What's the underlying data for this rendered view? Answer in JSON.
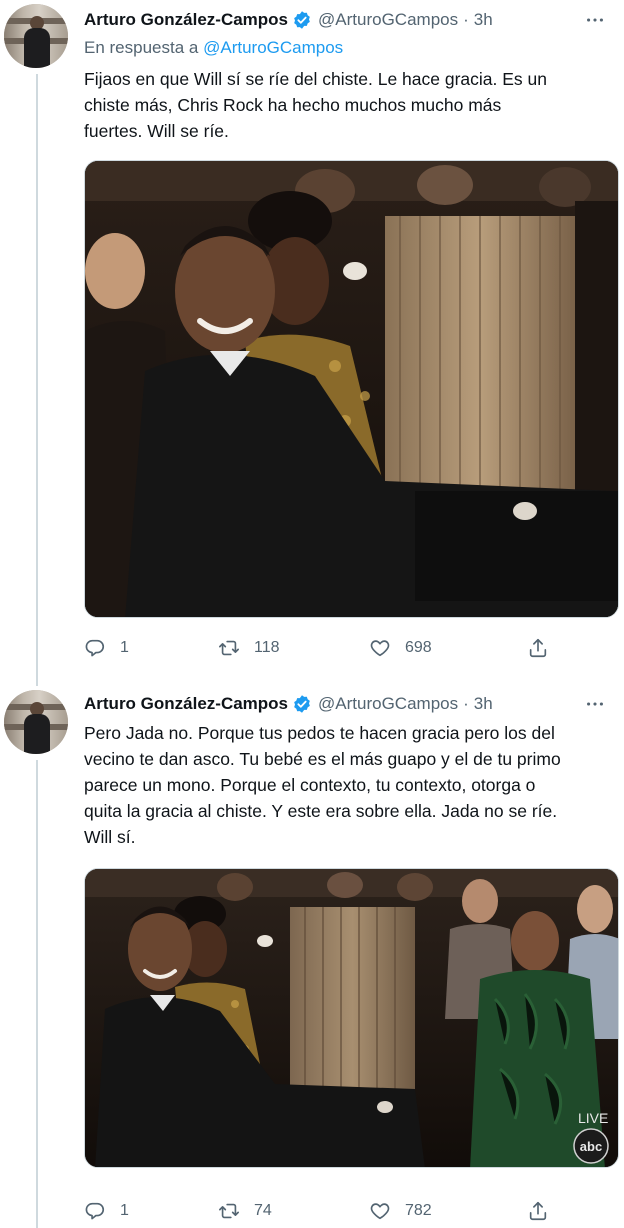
{
  "tweets": [
    {
      "name": "Arturo González-Campos",
      "handle": "@ArturoGCampos",
      "dot": "·",
      "time": "3h",
      "reply_prefix": "En respuesta a",
      "reply_handle": "@ArturoGCampos",
      "lines": [
        "Fijaos en que Will sí se ríe del chiste. Le hace gracia. Es un",
        "chiste más, Chris Rock ha hecho muchos mucho más",
        "fuertes. Will se ríe."
      ],
      "replies": "1",
      "retweets": "118",
      "likes": "698"
    },
    {
      "name": "Arturo González-Campos",
      "handle": "@ArturoGCampos",
      "dot": "·",
      "time": "3h",
      "lines": [
        "Pero Jada no. Porque tus pedos te hacen gracia pero los del",
        "vecino te dan asco. Tu bebé es el más guapo y el de tu primo",
        "parece un mono. Porque el contexto, tu contexto, otorga o",
        "quita la gracia al chiste. Y este era sobre ella. Jada no se ríe.",
        "Will sí."
      ],
      "replies": "1",
      "retweets": "74",
      "likes": "782",
      "media_overlay": {
        "live": "LIVE",
        "network": "abc"
      }
    }
  ],
  "icons": {
    "verified": "verified-badge-icon",
    "more": "more-options-icon",
    "reply": "reply-icon",
    "retweet": "retweet-icon",
    "like": "heart-icon",
    "share": "share-icon"
  },
  "colors": {
    "text": "#0f1419",
    "secondary": "#536471",
    "link": "#1d9bf0",
    "verified": "#1d9bf0",
    "thread_line": "#cfd9de"
  }
}
